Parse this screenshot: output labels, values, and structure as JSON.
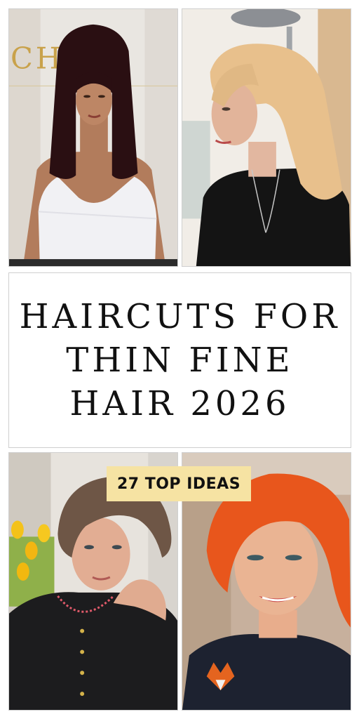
{
  "title": {
    "lines": [
      "HAIRCUTS FOR",
      "THIN FINE",
      "HAIR 2026"
    ]
  },
  "badge": {
    "label": "27 TOP IDEAS",
    "color": "#f6e3a3"
  },
  "photos": {
    "top_left": {
      "logo_text": "CHAI"
    },
    "top_right": {},
    "bottom_left": {},
    "bottom_right": {}
  },
  "colors": {
    "border": "#cfcfcf",
    "text": "#111111",
    "red_hair": "#e8561c",
    "blonde_hair": "#e8c08c",
    "dark_hair": "#2a0f12"
  }
}
